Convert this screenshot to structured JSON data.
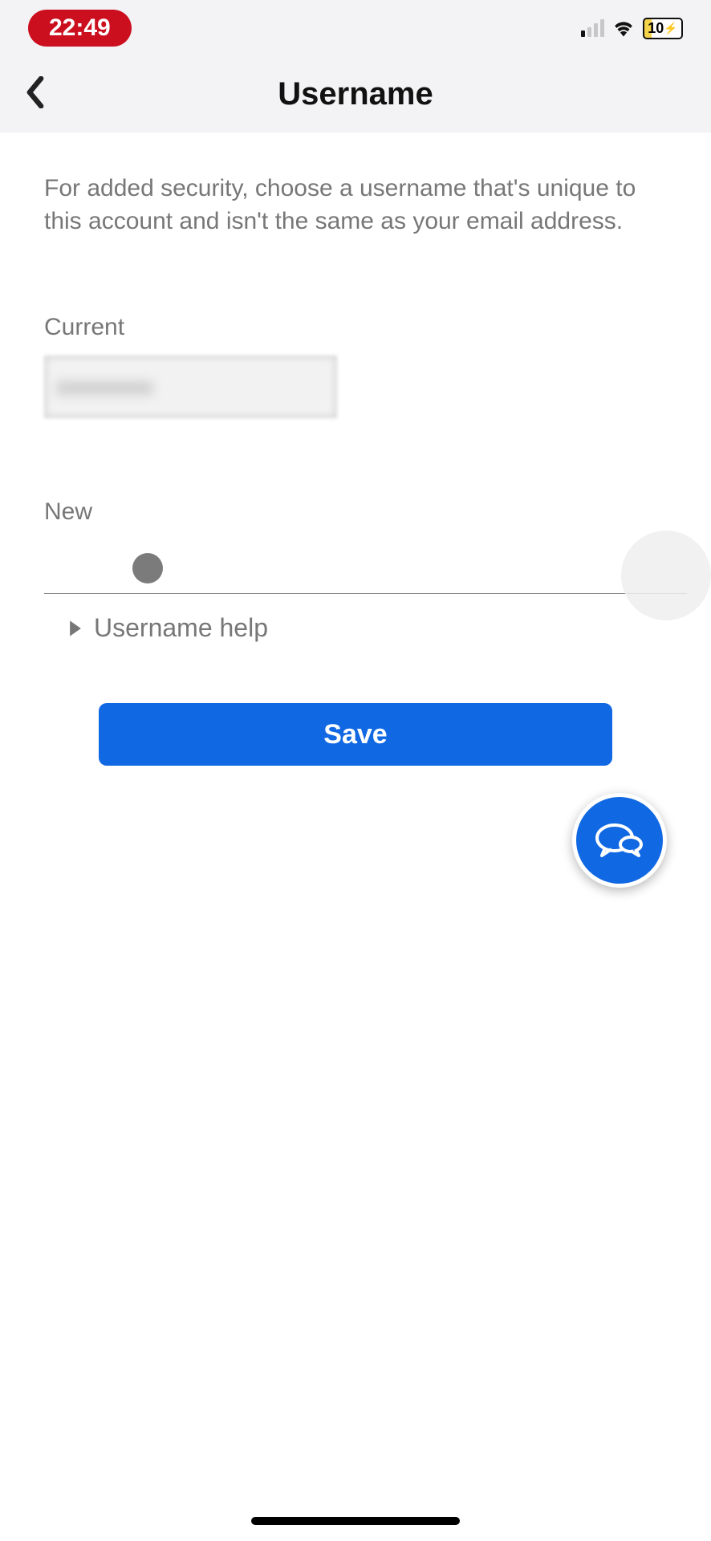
{
  "status_bar": {
    "time": "22:49",
    "battery_level": "10"
  },
  "header": {
    "title": "Username"
  },
  "content": {
    "description": "For added security, choose a username that's unique to this account and isn't the same as your email address.",
    "current_label": "Current",
    "new_label": "New",
    "help_label": "Username help",
    "save_label": "Save"
  }
}
